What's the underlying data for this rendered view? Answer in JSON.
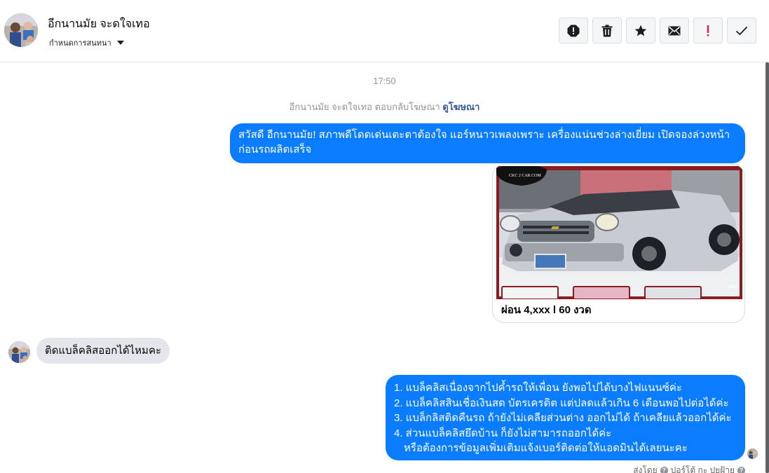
{
  "header": {
    "contact_name": "อีกนานมัย จะดใจเทอ",
    "assign_label": "กำหนดการสนทนา",
    "actions": [
      {
        "name": "report-icon",
        "label": "report"
      },
      {
        "name": "trash-icon",
        "label": "delete"
      },
      {
        "name": "star-icon",
        "label": "star"
      },
      {
        "name": "envelope-icon",
        "label": "mark unread"
      },
      {
        "name": "exclamation-icon",
        "label": "spam"
      },
      {
        "name": "check-icon",
        "label": "done"
      }
    ]
  },
  "conversation": {
    "timestamp": "17:50",
    "reply_note": "อีกนานมัย จะดใจเทอ ตอบกลับโฆษณา",
    "reply_link": "ดูโฆษณา",
    "messages": {
      "greeting": "สวัสดี อีกนานมัย! สภาพดีโดดเด่นเตะตาต้องใจ แอร์หนาวเพลงเพราะ เครื่องแน่นช่วงล่างเยี่ยม เปิดจองล่วงหน้าก่อนรถผลิตเสร็จ",
      "ad_caption": "ผ่อน 4,xxx l 60 งวด",
      "ad_logo_text": "CKC 2 CAR.COM",
      "ad_plate_text": "J092",
      "question": "ติดแบล็คลิสออกได้ไหมคะ",
      "reply_lines": [
        "1. แบล็คลิสเนื่องจากไปค้ำรถให้เพื่อน ยังพอไปได้บางไฟแนนซ์ค่ะ",
        "2. แบล็คลิสสินเชื่อเงินสด บัตรเครดิต แต่ปลดแล้วเกิน 6 เดือนพอไปต่อได้ค่ะ",
        "3. แบล็กลิสติดคืนรถ ถ้ายังไม่เคลียส่วนต่าง ออกไม่ได้ ถ้าเคลียแล้วออกได้ค่ะ",
        "4. ส่วนแบล็คลิสยึดบ้าน ก็ยังไม่สามารถออกได้ค่ะ",
        "หรือต้องการข้อมูลเพิ่มเติมแจ้งเบอร์ติดต่อให้แอดมินได้เลยนะคะ"
      ],
      "sent_by_prefix": "ส่งโดย",
      "sent_by_name": "ปอร์โต้ กะ ปยุฝ้าย"
    }
  },
  "colors": {
    "outgoing_bubble": "#0a7cff",
    "incoming_bubble": "#e4e6eb",
    "link": "#385898",
    "spam_red": "#e41e3f"
  }
}
